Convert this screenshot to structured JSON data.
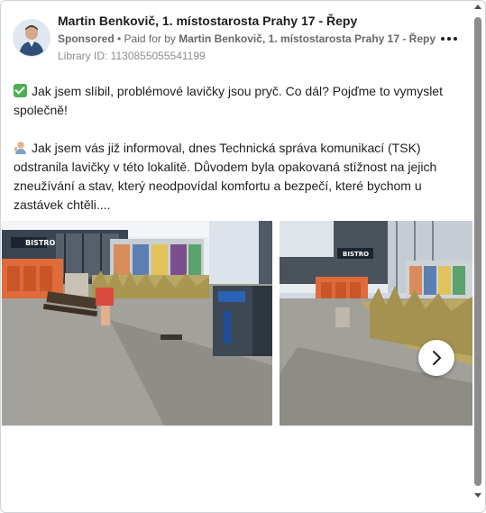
{
  "post": {
    "author": "Martin Benkovič, 1. místostarosta Prahy 17 - Řepy",
    "sponsored_label": "Sponsored",
    "separator": " • ",
    "paid_for_prefix": "Paid for by ",
    "paid_for_by": "Martin Benkovič, 1. místostarosta Prahy 17 - Řepy",
    "library_id": "Library ID: 1130855055541199",
    "paragraph_1": "Jak jsem slíbil, problémové lavičky jsou pryč. Co dál? Pojďme to vymyslet společně!",
    "paragraph_2": "Jak jsem vás již informoval, dnes Technická správa komunikací (TSK) odstranila lavičky v této lokalitě. Důvodem byla opakovaná stížnost na jejich zneužívání a stav, který neodpovídal komfortu a bezpečí, které bychom u zastávek chtěli...."
  },
  "icons": {
    "more": "more-options-icon",
    "check": "check-mark-emoji-icon",
    "person": "person-emoji-icon",
    "next": "chevron-right-icon"
  },
  "colors": {
    "text": "#1c1e21",
    "meta": "#65676b",
    "library": "#8a8d91",
    "check_emoji": "#4caf50"
  },
  "carousel": {
    "images": [
      {
        "sign_text": "BISTRO"
      },
      {
        "sign_text": "BISTRO"
      }
    ]
  }
}
